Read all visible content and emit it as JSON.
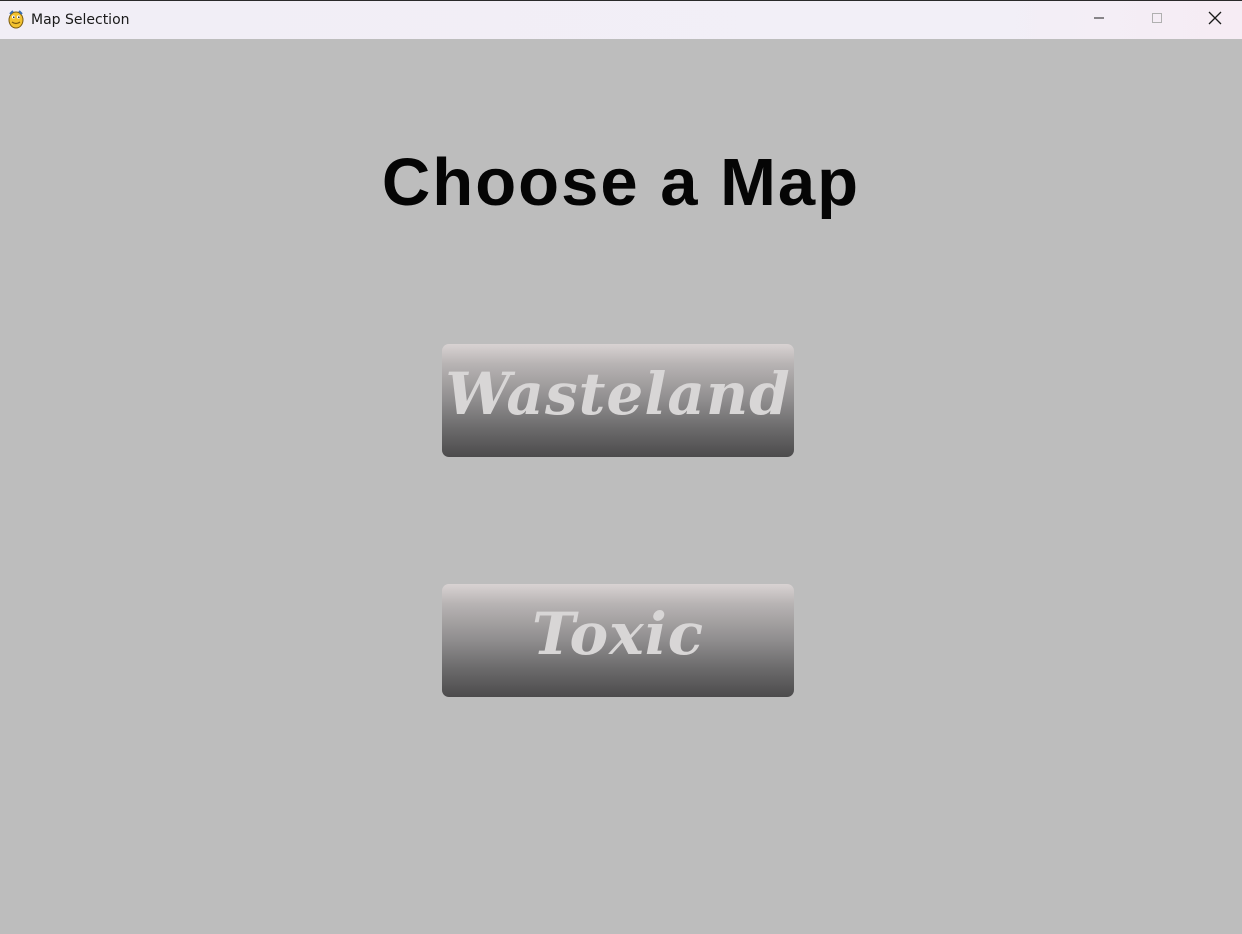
{
  "window": {
    "title": "Map Selection",
    "icon": "python-snake-icon",
    "controls": {
      "minimize": "minimize-icon",
      "maximize": "maximize-icon",
      "close": "close-icon"
    }
  },
  "main": {
    "heading": "Choose a Map",
    "buttons": [
      {
        "label": "Wasteland"
      },
      {
        "label": "Toxic"
      }
    ]
  },
  "colors": {
    "background": "#bdbdbd",
    "heading": "#050505",
    "button_top": "#d9d3d3",
    "button_bottom": "#4c4b4c",
    "button_text": "#d8d6d6"
  }
}
